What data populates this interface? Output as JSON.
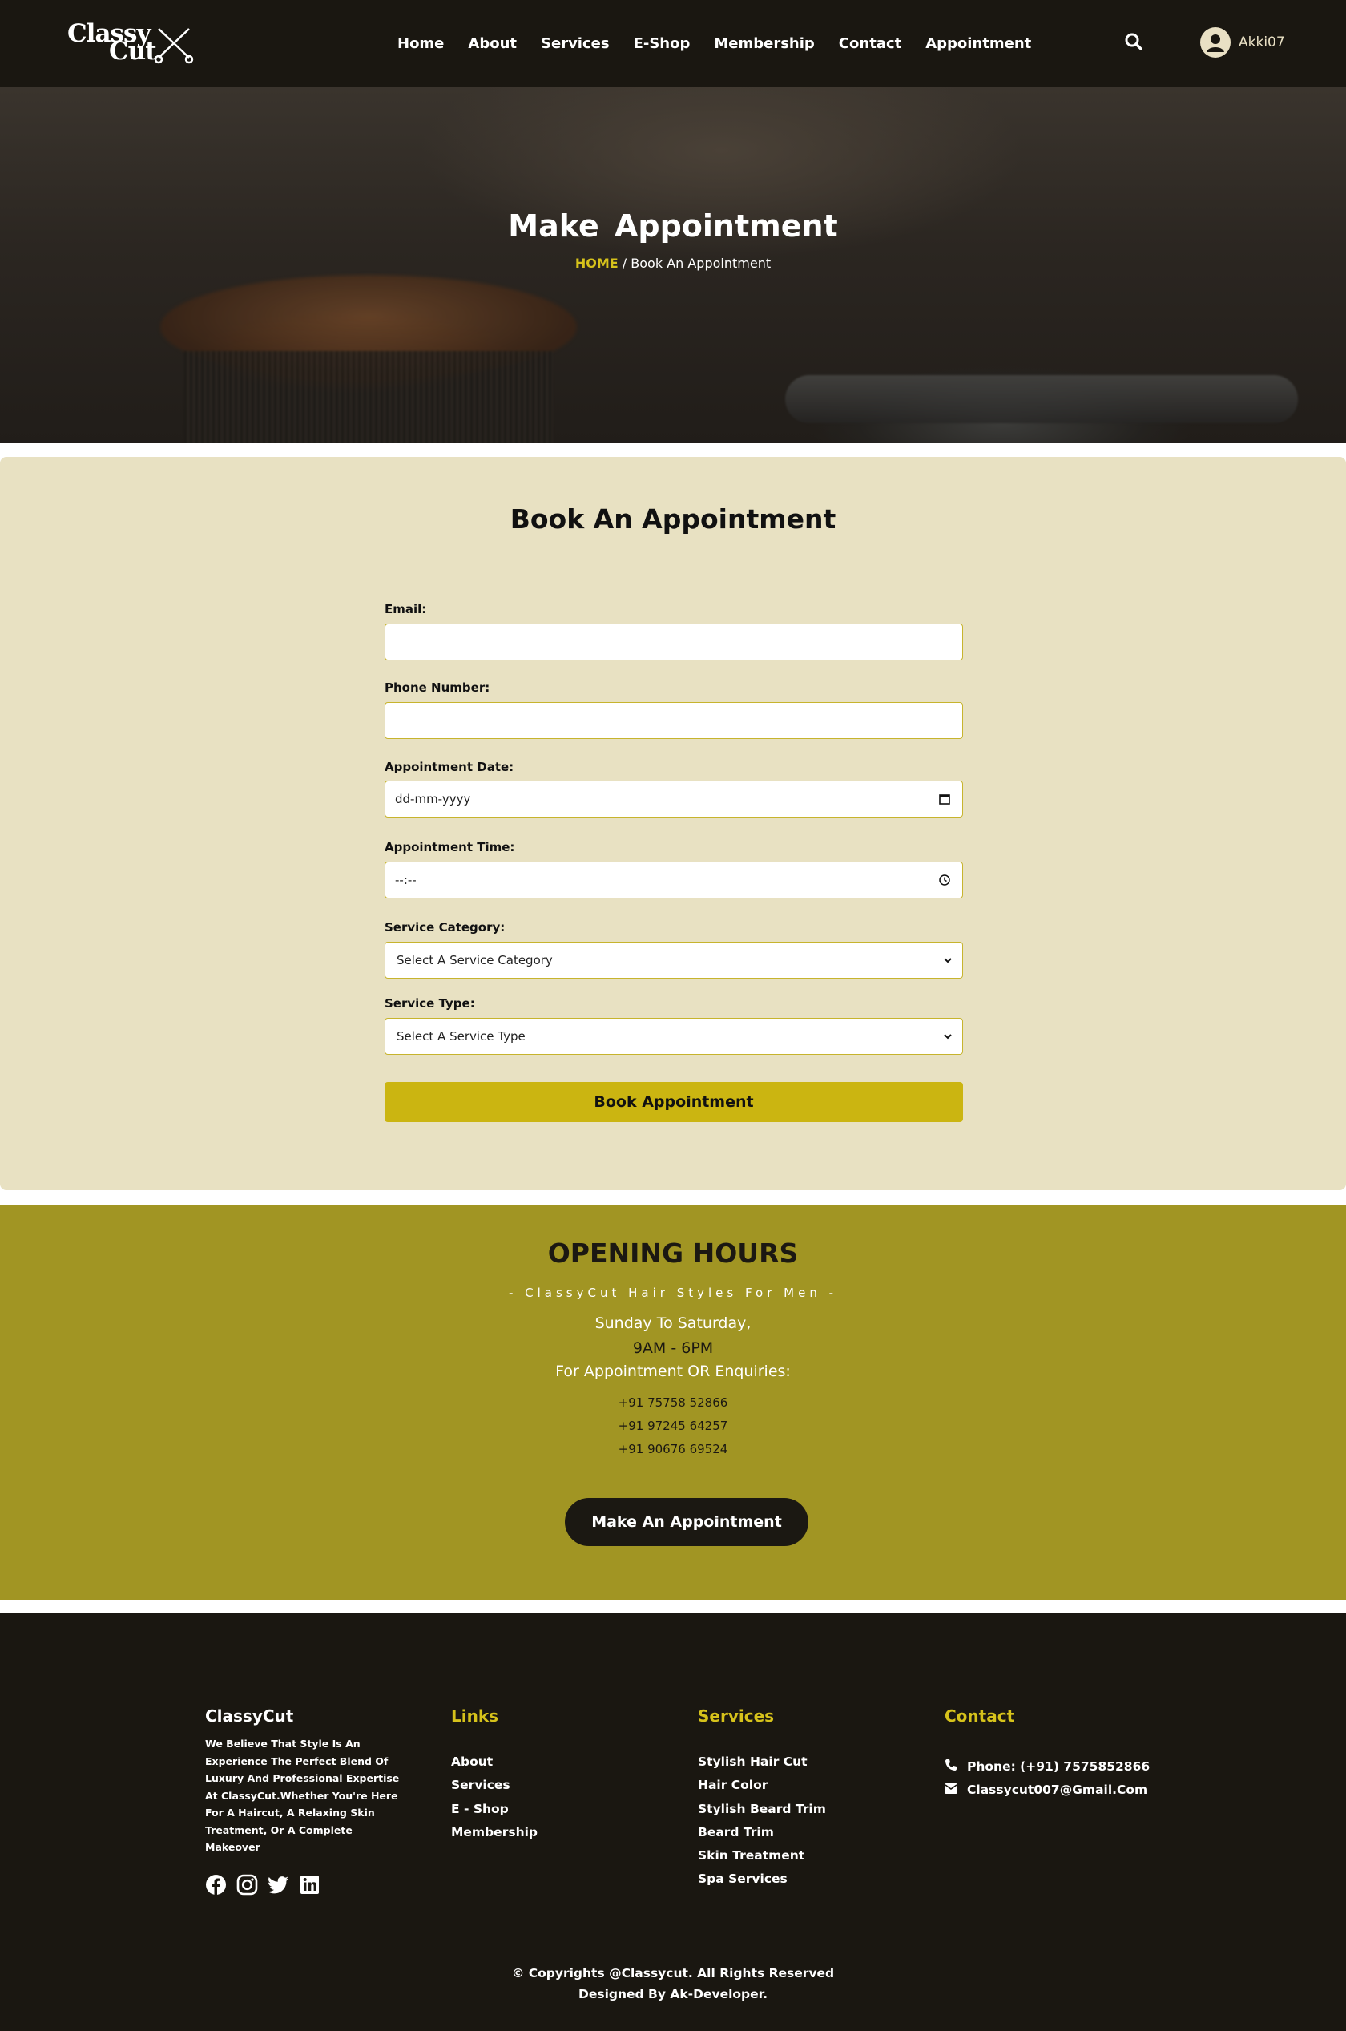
{
  "nav": {
    "logo_line1": "Classy",
    "logo_line2": "Cut",
    "items": [
      "Home",
      "About",
      "Services",
      "E-Shop",
      "Membership",
      "Contact",
      "Appointment"
    ],
    "username": "Akki07"
  },
  "hero": {
    "title": "Make  Appointment",
    "breadcrumb_home": "HOME",
    "breadcrumb_sep": " / ",
    "breadcrumb_current": "Book An Appointment"
  },
  "form": {
    "title": "Book An Appointment",
    "email_label": "Email:",
    "email_value": "",
    "phone_label": "Phone Number:",
    "phone_value": "",
    "date_label": "Appointment Date:",
    "date_placeholder": "dd-mm-yyyy",
    "time_label": "Appointment Time:",
    "time_placeholder": "--:--",
    "category_label": "Service Category:",
    "category_selected": "Select A Service Category",
    "type_label": "Service Type:",
    "type_selected": "Select A Service Type",
    "submit_label": "Book Appointment"
  },
  "hours": {
    "title": "OPENING HOURS",
    "subtitle": "- ClassyCut Hair Styles For Men -",
    "days": "Sunday To Saturday,",
    "time": "9AM - 6PM",
    "enquiries": "For Appointment OR Enquiries:",
    "phones": [
      "+91 75758 52866",
      "+91 97245 64257",
      "+91 90676 69524"
    ],
    "button_label": "Make An Appointment"
  },
  "footer": {
    "brand": "ClassyCut",
    "about": "We Believe That Style Is An Experience The Perfect Blend Of Luxury And Professional Expertise At ClassyCut.Whether You're Here For A Haircut, A Relaxing Skin Treatment, Or A Complete Makeover",
    "social_icons": [
      "facebook-icon",
      "instagram-icon",
      "twitter-icon",
      "linkedin-icon"
    ],
    "links_title": "Links",
    "links": [
      "About",
      "Services",
      "E - Shop",
      "Membership"
    ],
    "services_title": "Services",
    "services": [
      "Stylish Hair Cut",
      "Hair Color",
      "Stylish Beard Trim",
      "Beard Trim",
      "Skin Treatment",
      "Spa Services"
    ],
    "contact_title": "Contact",
    "phone": "Phone: (+91) 7575852866",
    "email": "Classycut007@Gmail.Com",
    "copyright": "© Copyrights @Classycut. All Rights Reserved",
    "designed_by": "Designed By Ak-Developer."
  },
  "colors": {
    "dark": "#1a1711",
    "accent": "#d6c21b",
    "form_bg": "#e8e1c2",
    "hours_bg": "#a19523",
    "button_gold": "#cbb511"
  }
}
